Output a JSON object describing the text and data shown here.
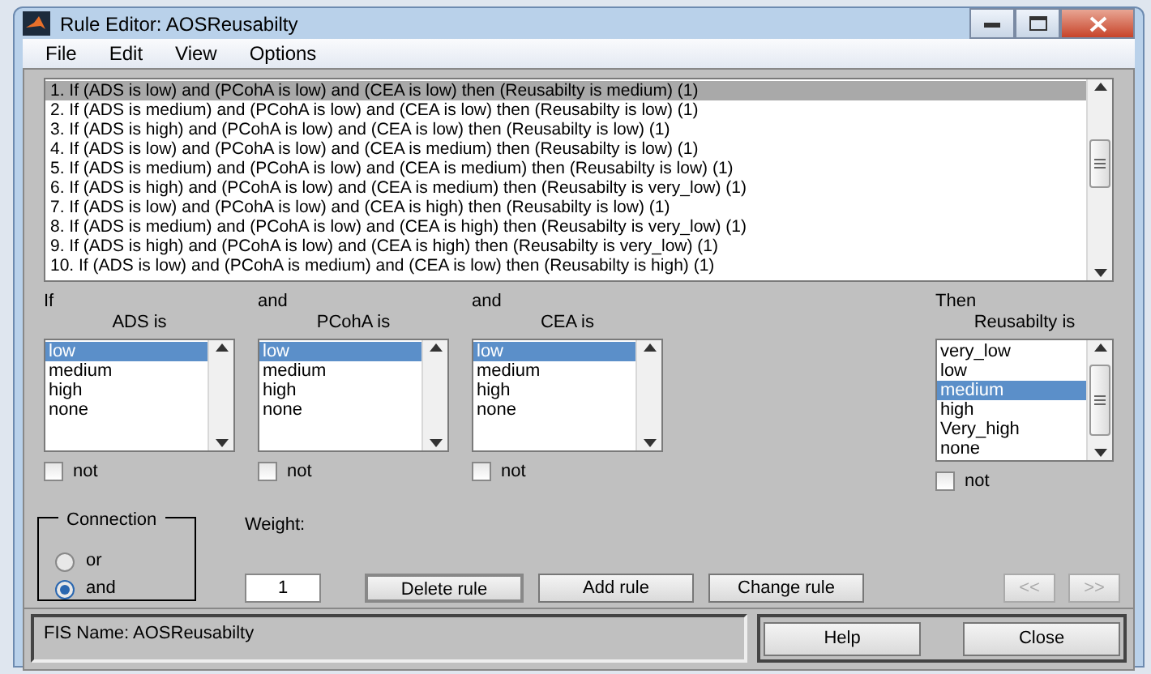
{
  "window": {
    "title": "Rule Editor: AOSReusabilty"
  },
  "menu": [
    "File",
    "Edit",
    "View",
    "Options"
  ],
  "rules": [
    {
      "text": "1. If (ADS is low) and (PCohA is low) and (CEA is low) then (Reusabilty is medium) (1)",
      "selected": true
    },
    {
      "text": "2. If (ADS is medium) and (PCohA is low) and (CEA is low) then (Reusabilty is low) (1)",
      "selected": false
    },
    {
      "text": "3. If (ADS is high) and (PCohA is low) and (CEA is low) then (Reusabilty is low) (1)",
      "selected": false
    },
    {
      "text": "4. If (ADS is low) and (PCohA is low) and (CEA is medium) then (Reusabilty is low) (1)",
      "selected": false
    },
    {
      "text": "5. If (ADS is medium) and (PCohA is low) and (CEA is medium) then (Reusabilty is low) (1)",
      "selected": false
    },
    {
      "text": "6. If (ADS is high) and (PCohA is low) and (CEA is medium) then (Reusabilty is very_low) (1)",
      "selected": false
    },
    {
      "text": "7. If (ADS is low) and (PCohA is low) and (CEA is high) then (Reusabilty is low) (1)",
      "selected": false
    },
    {
      "text": "8. If (ADS is medium) and (PCohA is low) and (CEA is high) then (Reusabilty is very_low) (1)",
      "selected": false
    },
    {
      "text": "9. If (ADS is high) and (PCohA is low) and (CEA is high) then (Reusabilty is very_low) (1)",
      "selected": false
    },
    {
      "text": "10. If (ADS is low) and (PCohA is medium) and (CEA is low) then (Reusabilty is high) (1)",
      "selected": false
    }
  ],
  "variables": [
    {
      "kind": "input",
      "prefix": "If",
      "label": "ADS is",
      "not": false,
      "not_label": "not",
      "options": [
        {
          "label": "low",
          "selected": true
        },
        {
          "label": "medium",
          "selected": false
        },
        {
          "label": "high",
          "selected": false
        },
        {
          "label": "none",
          "selected": false
        }
      ]
    },
    {
      "kind": "input",
      "prefix": "and",
      "label": "PCohA is",
      "not": false,
      "not_label": "not",
      "options": [
        {
          "label": "low",
          "selected": true
        },
        {
          "label": "medium",
          "selected": false
        },
        {
          "label": "high",
          "selected": false
        },
        {
          "label": "none",
          "selected": false
        }
      ]
    },
    {
      "kind": "input",
      "prefix": "and",
      "label": "CEA is",
      "not": false,
      "not_label": "not",
      "options": [
        {
          "label": "low",
          "selected": true
        },
        {
          "label": "medium",
          "selected": false
        },
        {
          "label": "high",
          "selected": false
        },
        {
          "label": "none",
          "selected": false
        }
      ]
    },
    {
      "kind": "output",
      "prefix": "Then",
      "label": "Reusabilty is",
      "not": false,
      "not_label": "not",
      "options": [
        {
          "label": "very_low",
          "selected": false
        },
        {
          "label": "low",
          "selected": false
        },
        {
          "label": "medium",
          "selected": true
        },
        {
          "label": "high",
          "selected": false
        },
        {
          "label": "Very_high",
          "selected": false
        },
        {
          "label": "none",
          "selected": false
        }
      ]
    }
  ],
  "connection": {
    "title": "Connection",
    "options": [
      {
        "label": "or",
        "selected": false
      },
      {
        "label": "and",
        "selected": true
      }
    ]
  },
  "weight": {
    "label": "Weight:",
    "value": "1"
  },
  "buttons": [
    {
      "label": "Delete rule",
      "disabled": false,
      "default": true
    },
    {
      "label": "Add rule",
      "disabled": false,
      "default": false
    },
    {
      "label": "Change rule",
      "disabled": false,
      "default": false
    }
  ],
  "nav_buttons": [
    {
      "label": "<<",
      "disabled": true
    },
    {
      "label": ">>",
      "disabled": true
    }
  ],
  "status": "FIS Name: AOSReusabilty",
  "footer_buttons": [
    "Help",
    "Close"
  ]
}
